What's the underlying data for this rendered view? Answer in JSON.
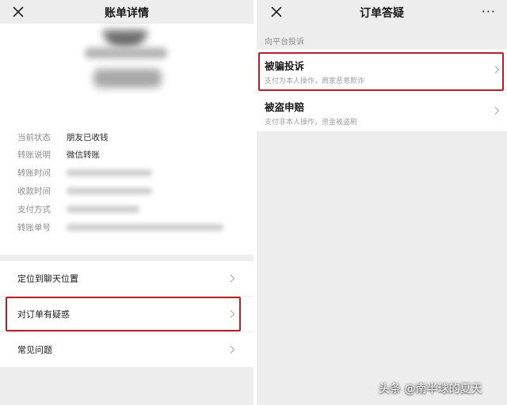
{
  "left": {
    "title": "账单详情",
    "details": [
      {
        "label": "当前状态",
        "value": "朋友已收钱"
      },
      {
        "label": "转账说明",
        "value": "微信转账"
      },
      {
        "label": "转账时间",
        "value": ""
      },
      {
        "label": "收款时间",
        "value": ""
      },
      {
        "label": "支付方式",
        "value": ""
      },
      {
        "label": "转账单号",
        "value": ""
      }
    ],
    "menu": [
      {
        "label": "定位到聊天位置"
      },
      {
        "label": "对订单有疑惑"
      },
      {
        "label": "常见问题"
      }
    ]
  },
  "right": {
    "title": "订单答疑",
    "more": "···",
    "section": "向平台投诉",
    "items": [
      {
        "title": "被骗投诉",
        "desc": "支付为本人操作，商家恶意欺诈"
      },
      {
        "title": "被盗申赔",
        "desc": "支付非本人操作，资金被盗刷"
      }
    ]
  },
  "watermark": "头条 @南半球的夏天",
  "icons": {
    "close": "close-icon",
    "chevron": "chevron-right-icon",
    "more": "more-icon"
  },
  "colors": {
    "highlight": "#b41f28",
    "background": "#ededed",
    "card": "#ffffff"
  }
}
